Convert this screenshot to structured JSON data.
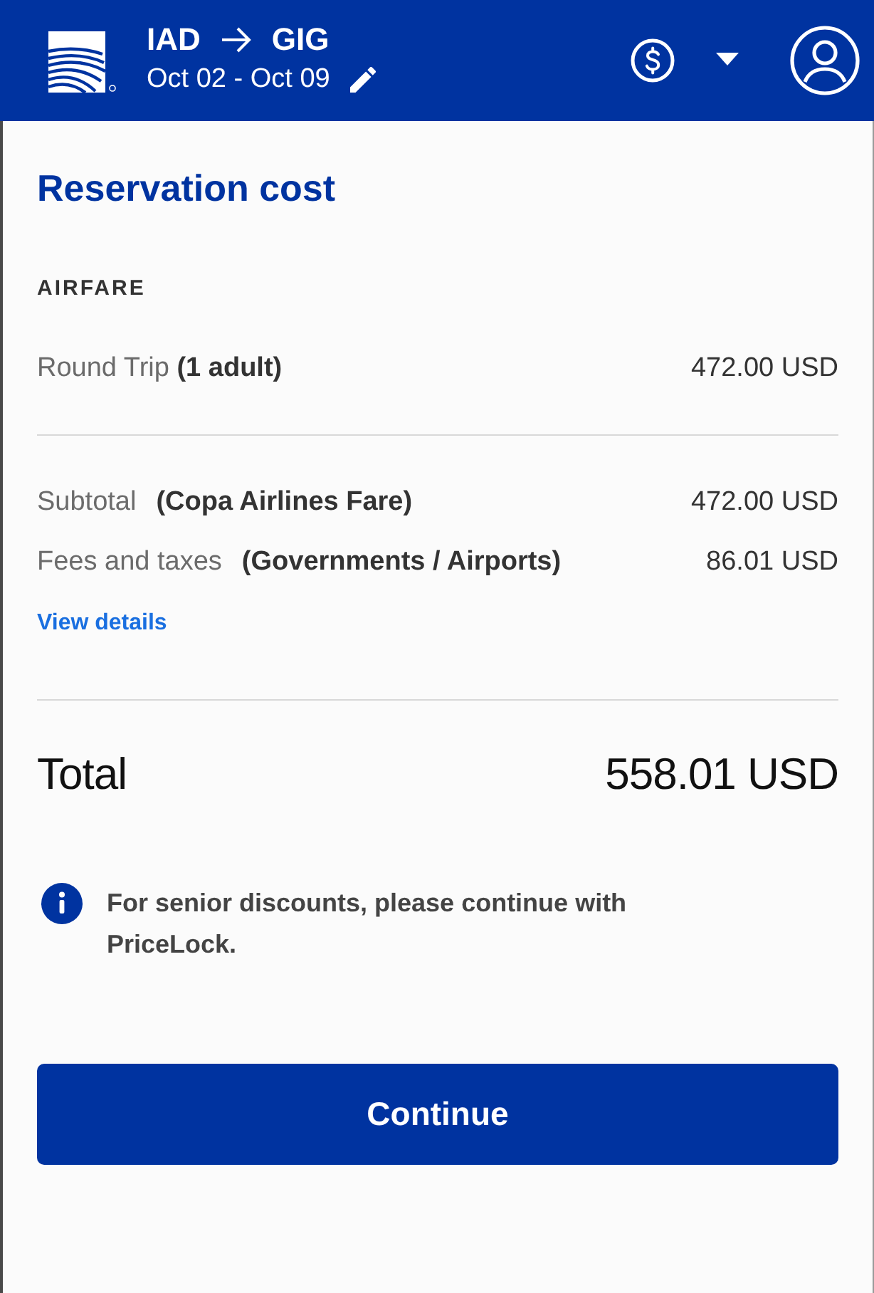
{
  "header": {
    "origin": "IAD",
    "destination": "GIG",
    "dates": "Oct 02 - Oct 09"
  },
  "cost": {
    "title": "Reservation cost",
    "section_label": "AIRFARE",
    "airfare_items": [
      {
        "label": "Round Trip **(1 adult)**",
        "amount": "472.00 USD"
      }
    ],
    "summary_rows": [
      {
        "label": "Subtotal",
        "note": "(Copa Airlines Fare)",
        "amount": "472.00 USD"
      },
      {
        "label": "Fees and taxes",
        "note": "(Governments / Airports)",
        "amount": "86.01 USD"
      }
    ],
    "details_link": "View details",
    "total": {
      "label": "Total",
      "amount": "558.01 USD"
    }
  },
  "notice": {
    "text": "For senior discounts, please continue with PriceLock."
  },
  "continue_button": {
    "label": "Continue"
  }
}
